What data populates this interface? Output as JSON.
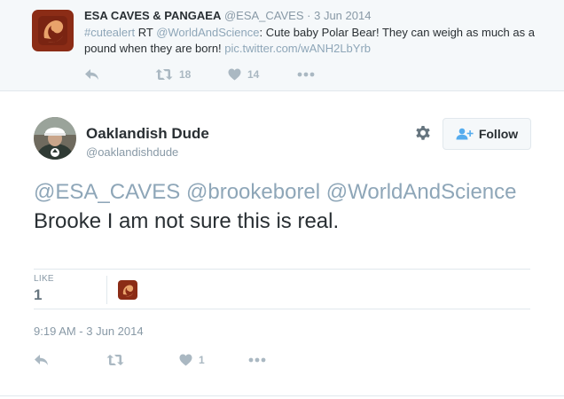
{
  "parent_tweet": {
    "author_name": "ESA CAVES & PANGAEA",
    "author_handle": "@ESA_CAVES",
    "separator": "·",
    "date": "3 Jun 2014",
    "text_parts": {
      "hashtag": "#cutealert",
      "rt": " RT ",
      "mention": "@WorldAndScience",
      "body": ": Cute baby Polar Bear! They can weigh as much as a pound when they are born! ",
      "link": "pic.twitter.com/wANH2LbYrb"
    },
    "actions": {
      "reply_icon": "reply-icon",
      "retweet_icon": "retweet-icon",
      "retweet_count": "18",
      "like_icon": "heart-icon",
      "like_count": "14",
      "more_icon": "more-dots-icon"
    }
  },
  "main_tweet": {
    "author_name": "Oaklandish Dude",
    "author_handle": "@oaklandishdude",
    "settings_icon": "gear-icon",
    "follow_label": "Follow",
    "follow_icon": "add-user-icon",
    "text_parts": {
      "mention1": "@ESA_CAVES",
      "mention2": "@brookeborel",
      "mention3": "@WorldAndScience",
      "body": " Brooke I am not sure this is real."
    },
    "stats": {
      "like_label": "LIKE",
      "like_count": "1"
    },
    "timestamp": "9:19 AM - 3 Jun 2014",
    "actions": {
      "reply_icon": "reply-icon",
      "retweet_icon": "retweet-icon",
      "like_icon": "heart-icon",
      "like_count": "1",
      "more_icon": "more-dots-icon"
    }
  },
  "colors": {
    "link": "#8ea6b8",
    "muted": "#8899a6",
    "text": "#292f33",
    "follow_accent": "#55acee",
    "parent_bg": "#f5f8fa",
    "logo_bg": "#8b2c16",
    "logo_fg": "#e9a36b"
  }
}
